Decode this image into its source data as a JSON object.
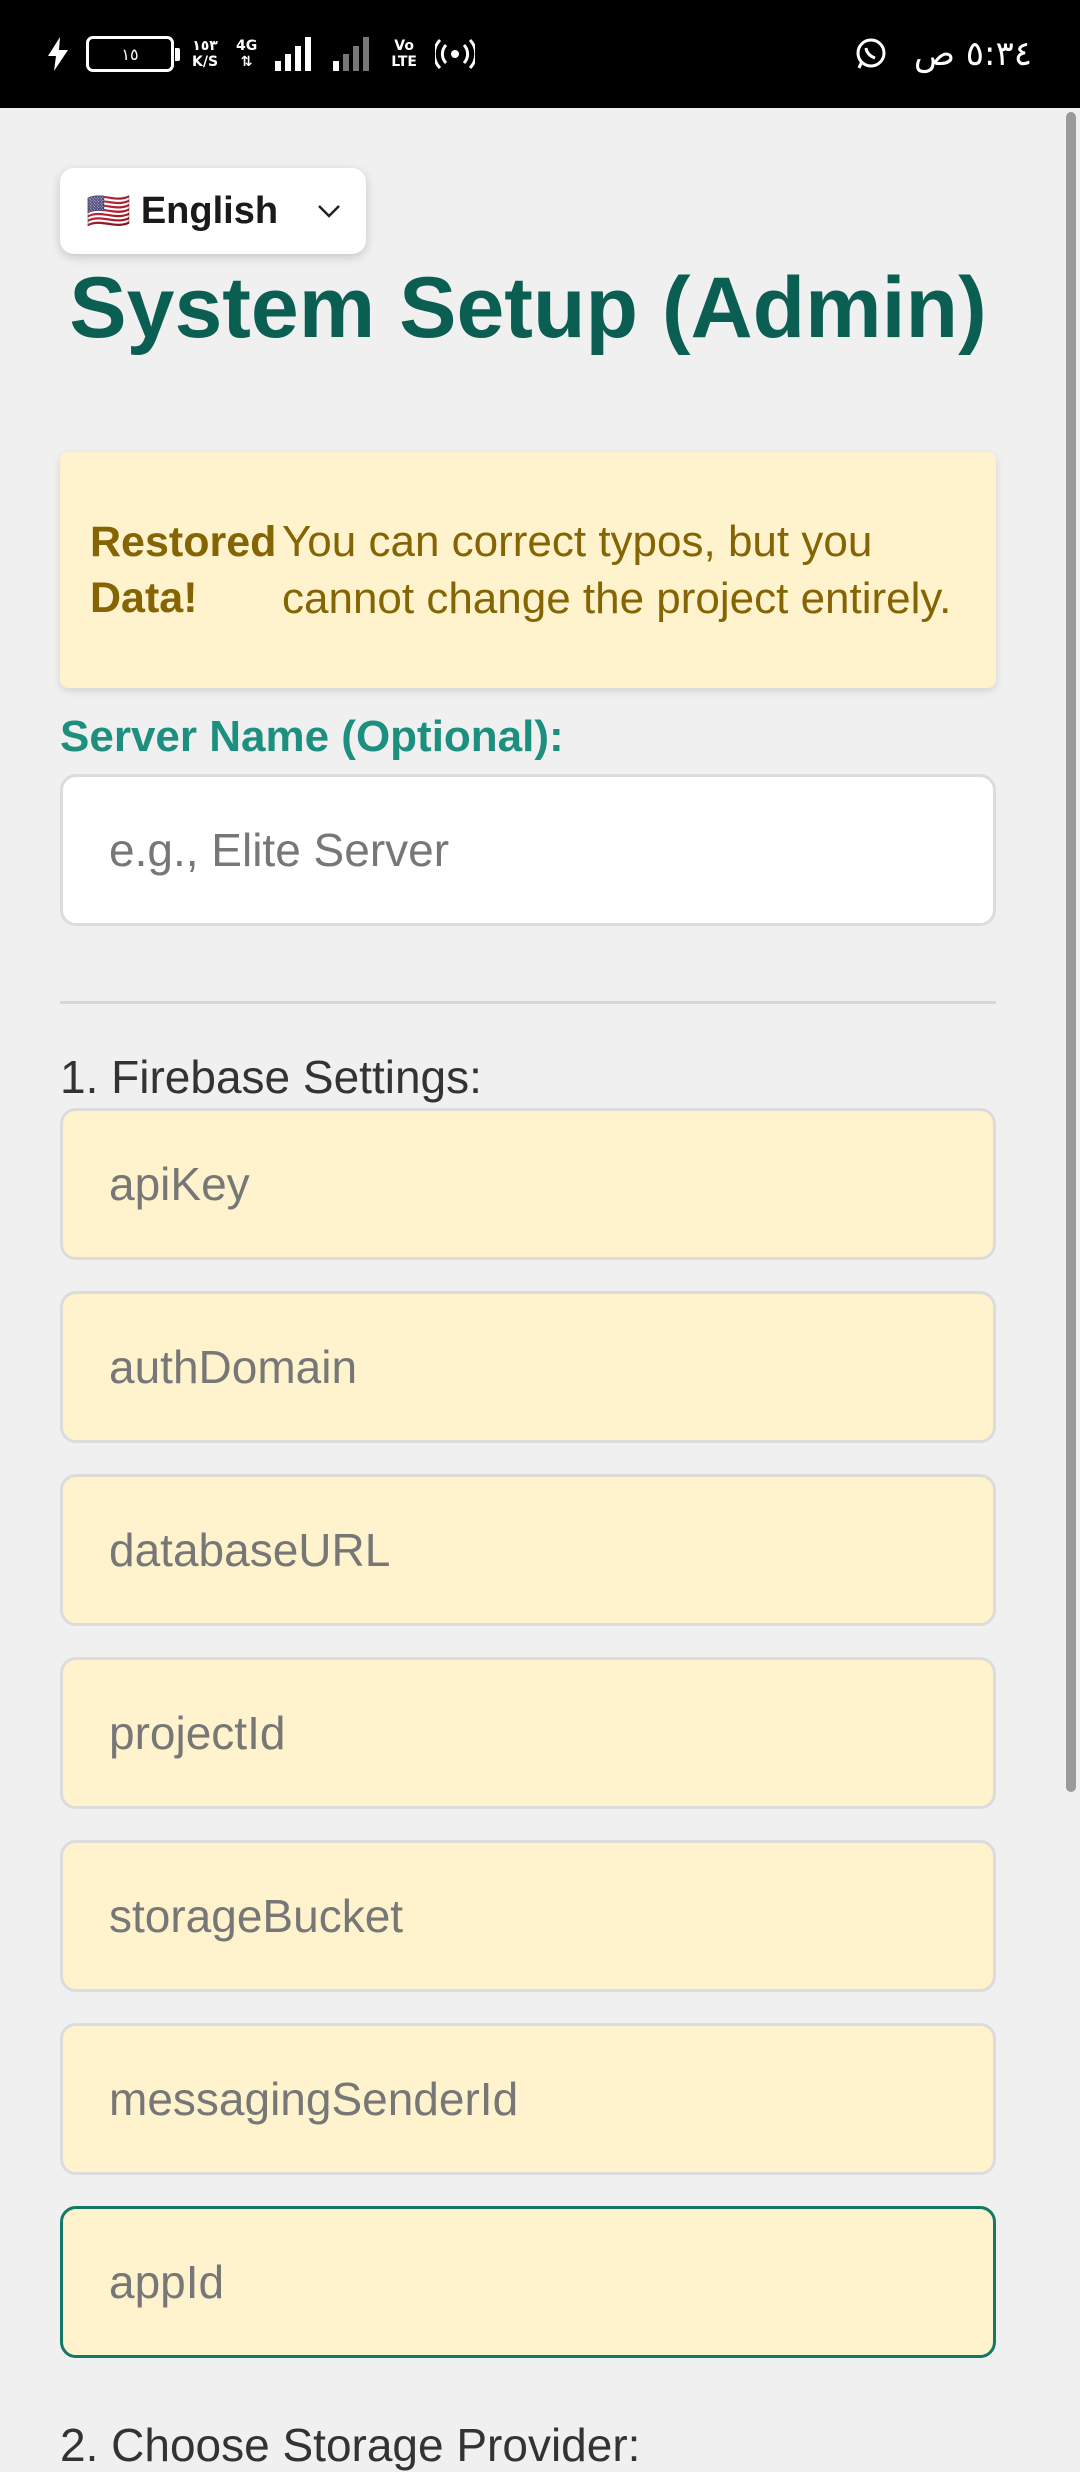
{
  "status_bar": {
    "time": "٥:٣٤ ص",
    "battery": "١٥",
    "network_speed": "١٥٣\nK/S",
    "network_type": "4G",
    "volte": "Vo\nLTE",
    "icons": [
      "charging-bolt-icon",
      "battery-icon",
      "signal-icon",
      "signal-weak-icon",
      "hotspot-icon",
      "whatsapp-icon"
    ]
  },
  "language_selector": {
    "flag": "🇺🇸",
    "label": "English"
  },
  "page": {
    "title": "System Setup (Admin)"
  },
  "alert": {
    "strong": "Restored Data!",
    "text": "You can correct typos, but you cannot change the project entirely."
  },
  "server_name": {
    "label": "Server Name (Optional):",
    "placeholder": "e.g., Elite Server"
  },
  "firebase": {
    "label": "1. Firebase Settings:",
    "fields": [
      {
        "placeholder": "apiKey"
      },
      {
        "placeholder": "authDomain"
      },
      {
        "placeholder": "databaseURL"
      },
      {
        "placeholder": "projectId"
      },
      {
        "placeholder": "storageBucket"
      },
      {
        "placeholder": "messagingSenderId"
      },
      {
        "placeholder": "appId"
      }
    ]
  },
  "storage": {
    "label": "2. Choose Storage Provider:"
  },
  "colors": {
    "title": "#0b5e52",
    "label_accent": "#1c8f7f",
    "alert_bg": "#fff3cd",
    "alert_text": "#856404",
    "focus_border": "#137866"
  }
}
